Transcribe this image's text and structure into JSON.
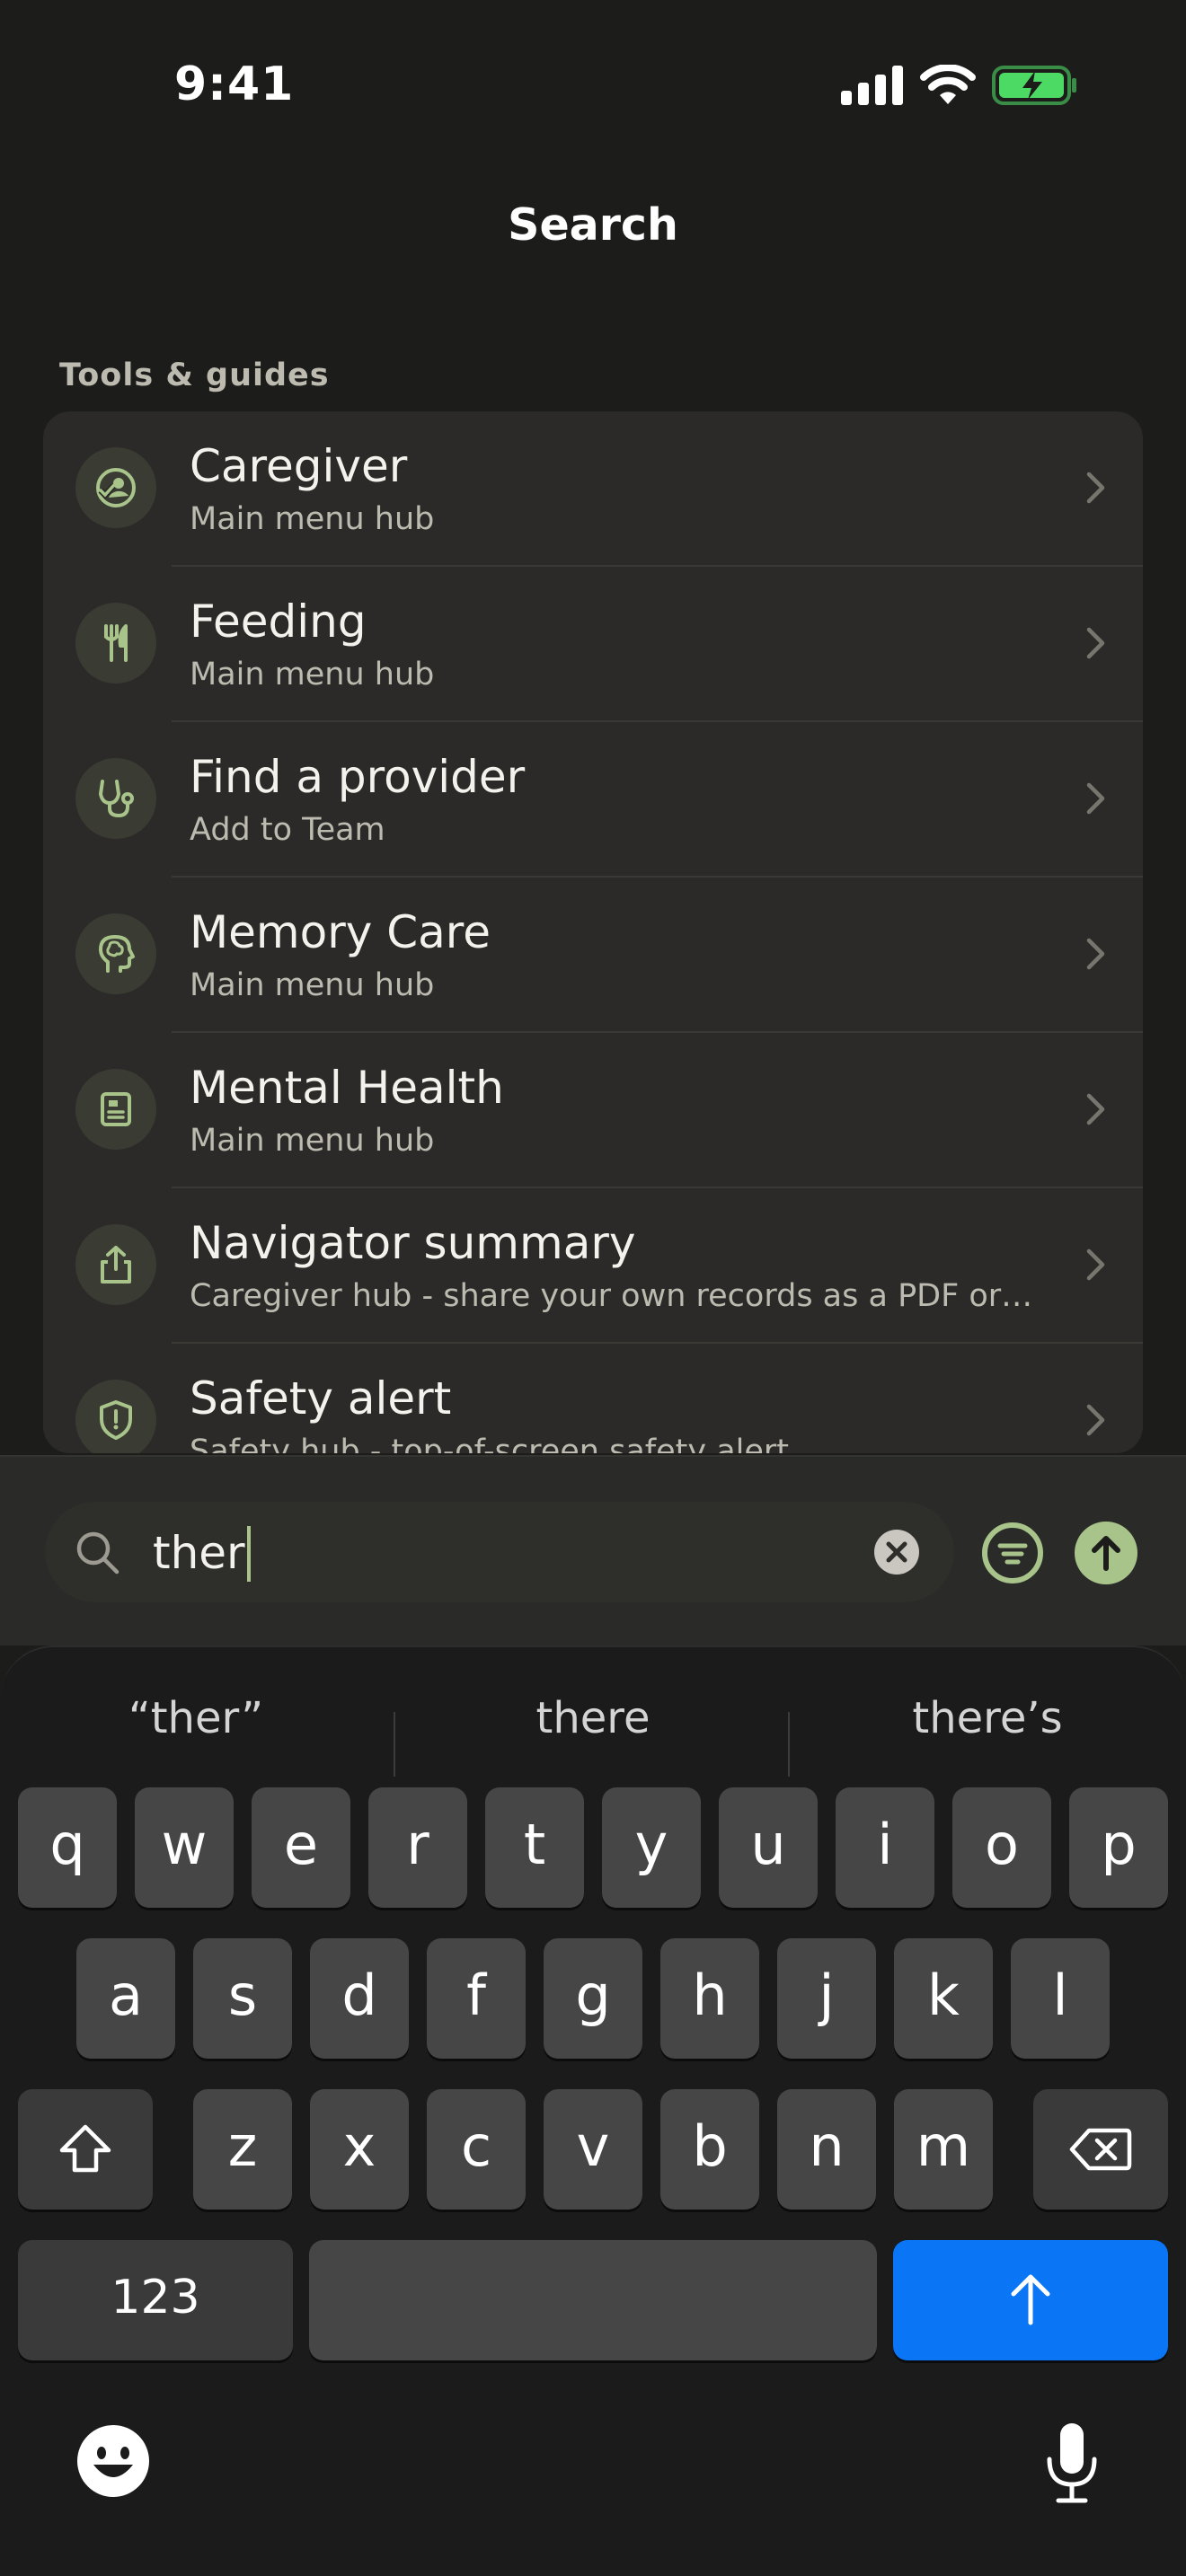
{
  "status": {
    "time": "9:41"
  },
  "nav": {
    "title": "Search"
  },
  "section": {
    "header": "Tools & guides"
  },
  "items": [
    {
      "title": "Caregiver",
      "subtitle": "Main menu hub",
      "icon": "caregiver-icon"
    },
    {
      "title": "Feeding",
      "subtitle": "Main menu hub",
      "icon": "utensils-icon"
    },
    {
      "title": "Find a provider",
      "subtitle": "Add to Team",
      "icon": "stethoscope-icon"
    },
    {
      "title": "Memory Care",
      "subtitle": "Main menu hub",
      "icon": "brain-head-icon"
    },
    {
      "title": "Mental Health",
      "subtitle": "Main menu hub",
      "icon": "journal-icon"
    },
    {
      "title": "Navigator summary",
      "subtitle": "Caregiver hub - share your own records as a PDF or…",
      "icon": "share-icon"
    },
    {
      "title": "Safety alert",
      "subtitle": "Safety hub - top-of-screen safety alert",
      "icon": "shield-alert-icon"
    }
  ],
  "search": {
    "query": "ther"
  },
  "keyboard": {
    "suggestions": [
      "“ther”",
      "there",
      "there’s"
    ],
    "row1": [
      "q",
      "w",
      "e",
      "r",
      "t",
      "y",
      "u",
      "i",
      "o",
      "p"
    ],
    "row2": [
      "a",
      "s",
      "d",
      "f",
      "g",
      "h",
      "j",
      "k",
      "l"
    ],
    "row3": [
      "z",
      "x",
      "c",
      "v",
      "b",
      "n",
      "m"
    ],
    "numbers_label": "123"
  },
  "colors": {
    "accent": "#a8c48a",
    "background": "#1c1c1b",
    "card": "#2b2a28",
    "return_key": "#0a76f6",
    "battery": "#4cd964"
  }
}
